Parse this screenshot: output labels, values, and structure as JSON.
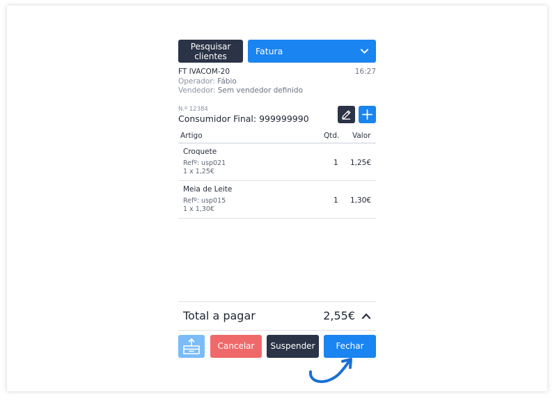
{
  "header": {
    "search_clients_label": "Pesquisar clientes",
    "doc_type": "Fatura"
  },
  "document": {
    "id": "FT IVACOM-20",
    "time": "16:27",
    "operator_label": "Operador:",
    "operator": "Fábio",
    "seller_label": "Vendedor:",
    "seller": "Sem vendedor definido"
  },
  "customer": {
    "number": "N.º 12384",
    "name": "Consumidor Final: 999999990"
  },
  "table": {
    "headers": {
      "item": "Artigo",
      "qty": "Qtd.",
      "value": "Valor"
    },
    "rows": [
      {
        "name": "Croquete",
        "ref": "Refº: usp021",
        "unit": "1 x 1,25€",
        "qty": "1",
        "value": "1,25€"
      },
      {
        "name": "Meia de Leite",
        "ref": "Refº: usp015",
        "unit": "1 x 1,30€",
        "qty": "1",
        "value": "1,30€"
      }
    ]
  },
  "total": {
    "label": "Total a pagar",
    "amount": "2,55€"
  },
  "actions": {
    "cancel": "Cancelar",
    "suspend": "Suspender",
    "close": "Fechar"
  },
  "icons": {
    "doc_type_chevron": "chevron-down-icon",
    "edit": "pencil-icon",
    "add": "plus-icon",
    "total_toggle": "chevron-up-icon",
    "drawer": "cash-drawer-icon"
  },
  "colors": {
    "primary": "#1a84f0",
    "dark": "#2b3346",
    "danger": "#f0696a",
    "light_primary": "#7bbcf7"
  }
}
